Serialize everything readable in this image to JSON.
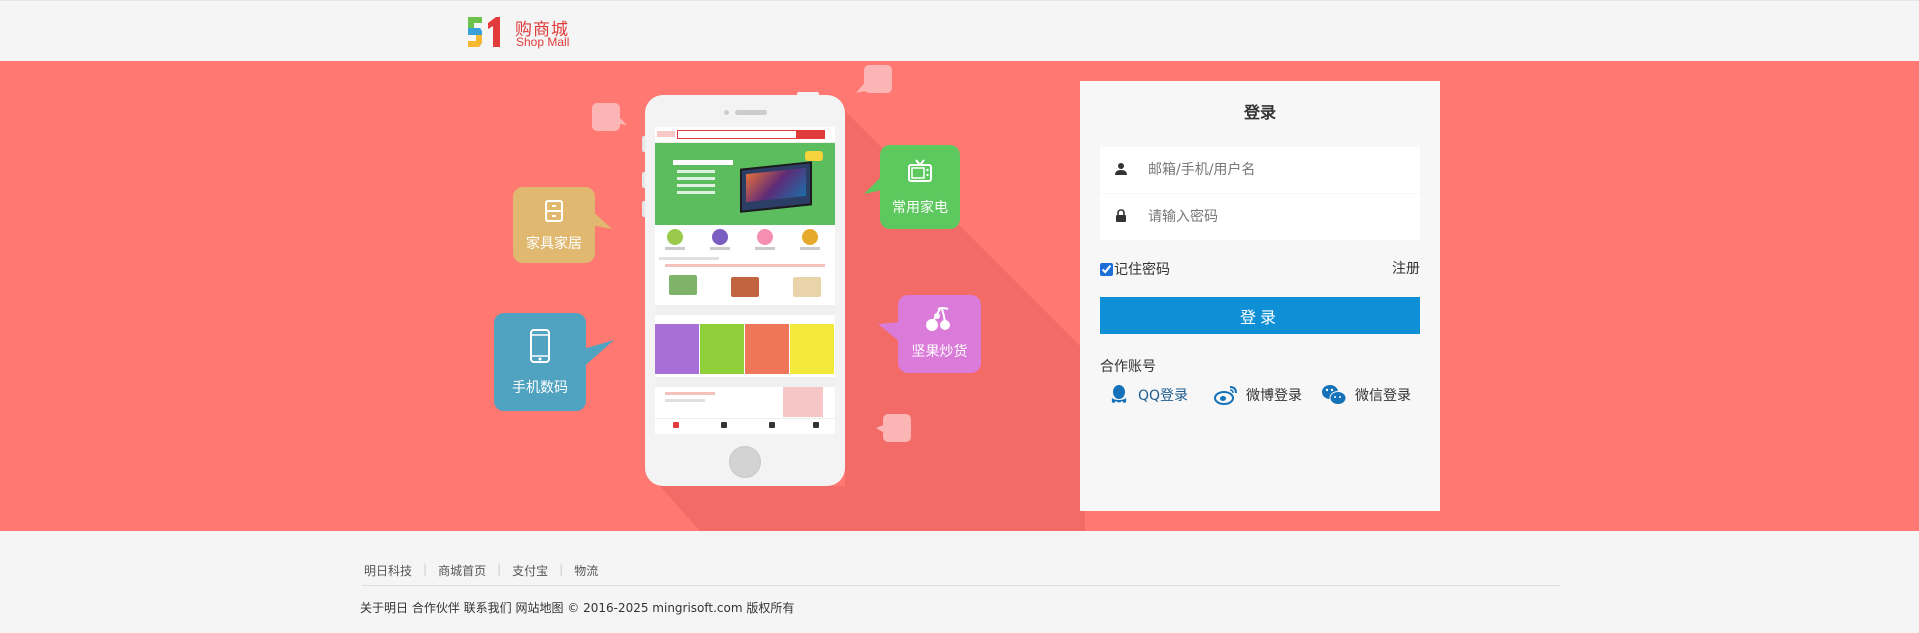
{
  "header": {
    "logo_mark": "51",
    "logo_cn": "购商城",
    "logo_en": "Shop Mall"
  },
  "banner": {
    "bubbles": {
      "furniture": "家具家居",
      "appliance": "常用家电",
      "digital": "手机数码",
      "snacks": "坚果炒货"
    },
    "colors": {
      "background": "#ff7871",
      "furniture": "#e0b86f",
      "appliance": "#5cc85e",
      "digital": "#4fa3c1",
      "snacks": "#da7ad9"
    }
  },
  "login": {
    "title": "登录",
    "username_placeholder": "邮箱/手机/用户名",
    "password_placeholder": "请输入密码",
    "remember_label": "记住密码",
    "remember_checked": true,
    "register_label": "注册",
    "submit_label": "登录",
    "partner_label": "合作账号",
    "social": {
      "qq": "QQ登录",
      "weibo": "微博登录",
      "wechat": "微信登录"
    },
    "accent_color": "#0e8fd6"
  },
  "footer": {
    "links": [
      "明日科技",
      "商城首页",
      "支付宝",
      "物流"
    ],
    "copyright": "关于明日 合作伙伴 联系我们 网站地图 © 2016-2025 mingrisoft.com 版权所有"
  }
}
